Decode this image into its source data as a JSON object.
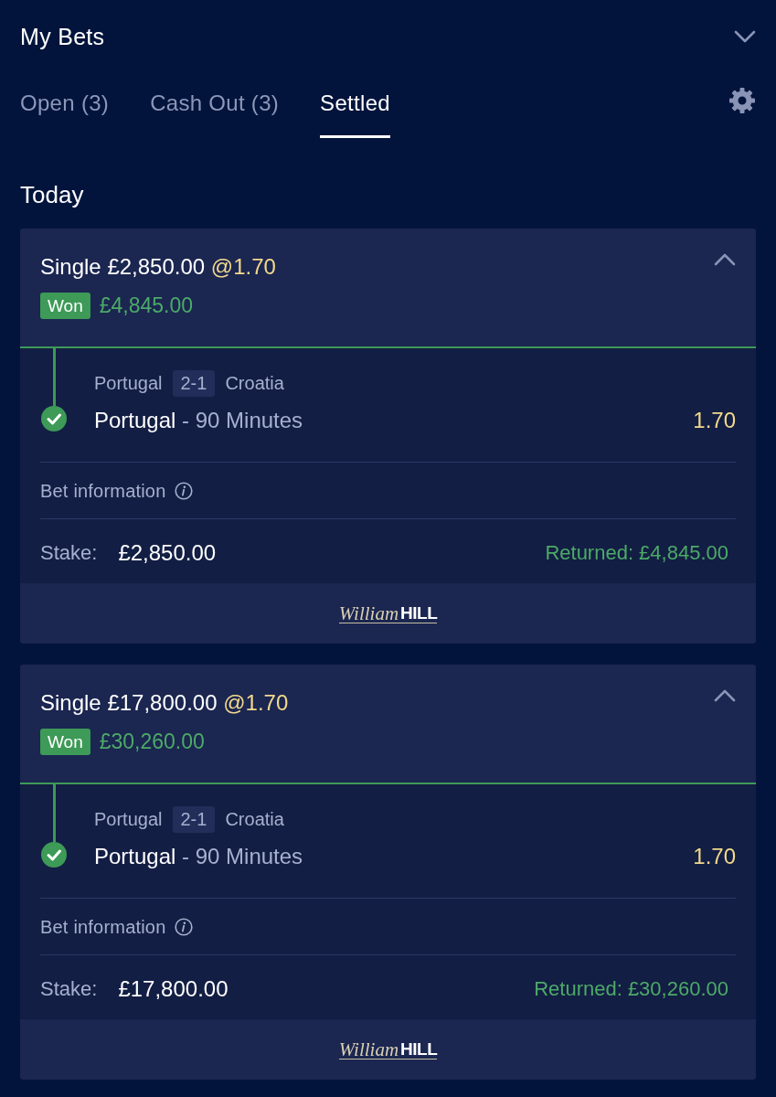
{
  "header": {
    "title": "My Bets",
    "expanded": true
  },
  "tabs": [
    {
      "label": "Open (3)",
      "selected": false
    },
    {
      "label": "Cash Out (3)",
      "selected": false
    },
    {
      "label": "Settled",
      "selected": true
    }
  ],
  "section": {
    "title": "Today"
  },
  "bets": [
    {
      "type": "Single",
      "stake_amount": "£2,850.00",
      "odds": "@1.70",
      "expanded": true,
      "won": true,
      "result": "Won",
      "result_amount": "£4,845.00",
      "selection": {
        "home": "Portugal",
        "score": "2-1",
        "away": "Croatia",
        "pick": "Portugal",
        "market": "- 90 Minutes",
        "odds": "1.70",
        "won": true
      },
      "info_label": "Bet information",
      "stake_label": "Stake:",
      "stake": "£2,850.00",
      "returned": "Returned: £4,845.00",
      "logo": {
        "script": "William",
        "bold": "HILL"
      }
    },
    {
      "type": "Single",
      "stake_amount": "£17,800.00",
      "odds": "@1.70",
      "expanded": true,
      "won": true,
      "result": "Won",
      "result_amount": "£30,260.00",
      "selection": {
        "home": "Portugal",
        "score": "2-1",
        "away": "Croatia",
        "pick": "Portugal",
        "market": "- 90 Minutes",
        "odds": "1.70",
        "won": true
      },
      "info_label": "Bet information",
      "stake_label": "Stake:",
      "stake": "£17,800.00",
      "returned": "Returned: £30,260.00",
      "logo": {
        "script": "William",
        "bold": "HILL"
      }
    }
  ]
}
